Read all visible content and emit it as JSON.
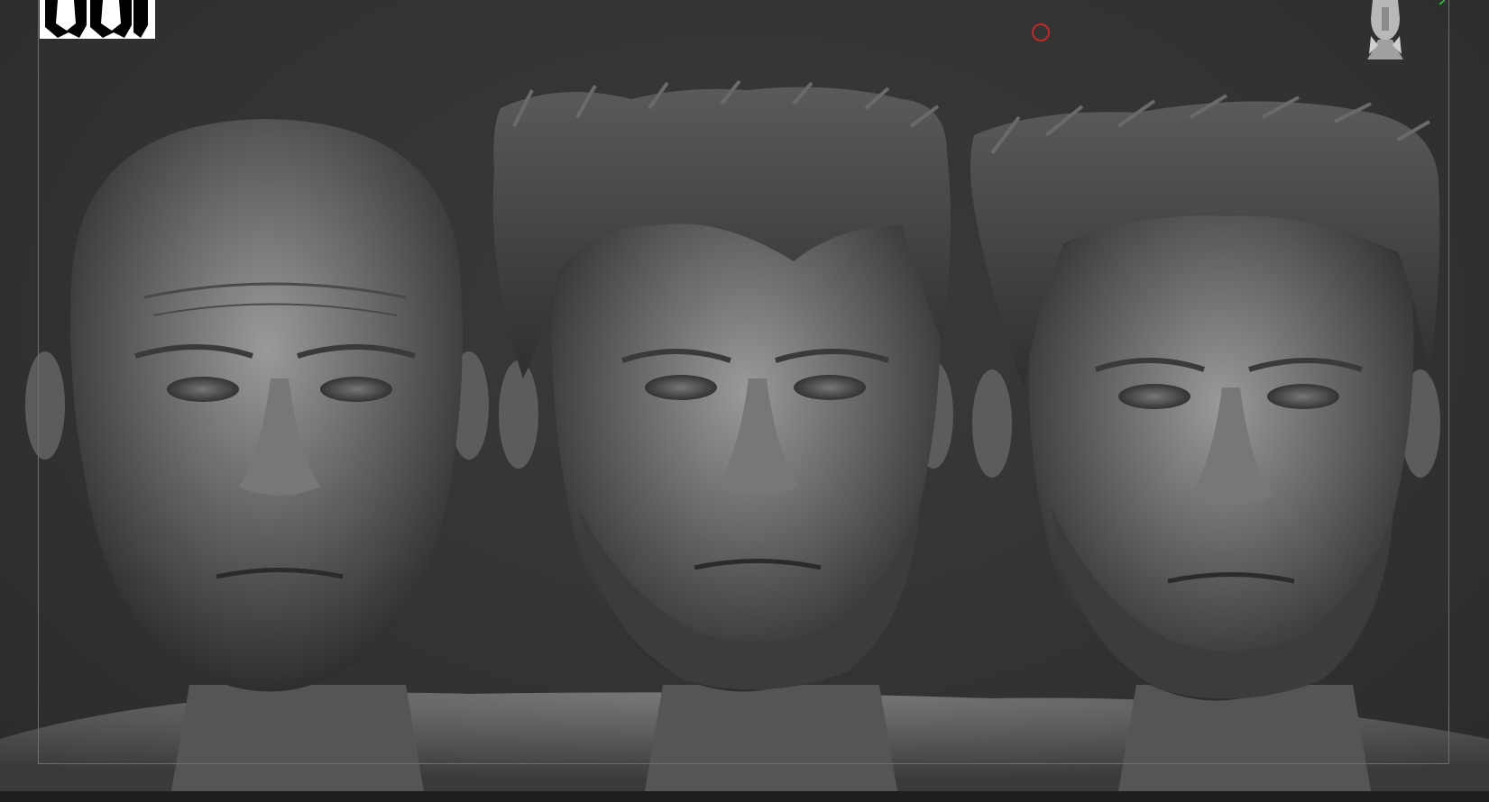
{
  "app": {
    "title": "",
    "viewport_background": "#333333",
    "frame_color": "#6e6e6e",
    "accent_cursor_color": "#c22a2a"
  },
  "viewport": {
    "models": [
      {
        "id": "bald",
        "icon": "bald-head-sculpt"
      },
      {
        "id": "short-hair",
        "icon": "spiky-hair-head-sculpt"
      },
      {
        "id": "long-hair",
        "icon": "swept-hair-head-sculpt"
      }
    ],
    "overlays": {
      "logo_icon": "studio-logo-icon",
      "cursor_icon": "brush-cursor-ring-icon",
      "navigation_icon": "navigation-head-icon"
    }
  }
}
